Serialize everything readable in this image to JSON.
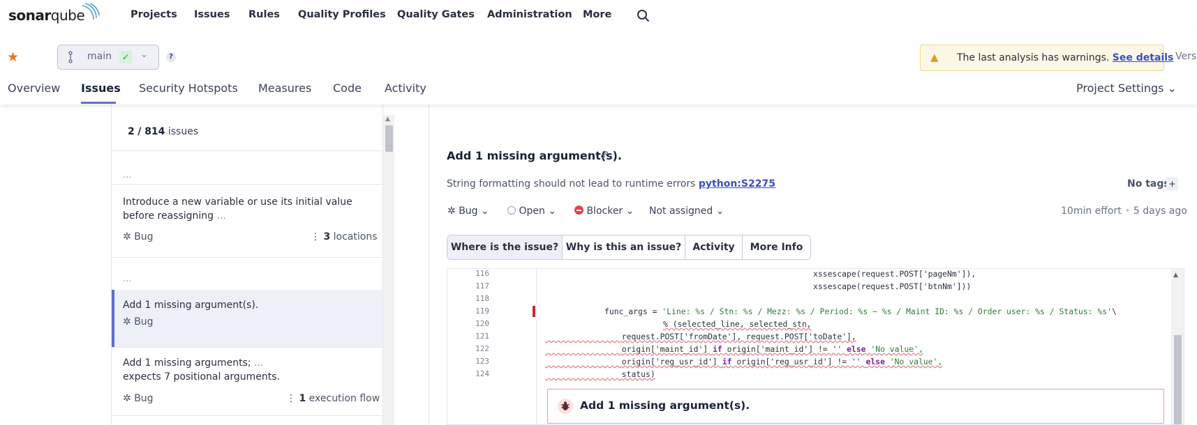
{
  "brand": {
    "name_bold": "sonar",
    "name_light": "qube"
  },
  "nav": [
    "Projects",
    "Issues",
    "Rules",
    "Quality Profiles",
    "Quality Gates",
    "Administration",
    "More"
  ],
  "branch": {
    "name": "main"
  },
  "help": "?",
  "warning": {
    "text": "The last analysis has warnings.",
    "link": "See details"
  },
  "version": "Versi",
  "tabs": [
    "Overview",
    "Issues",
    "Security Hotspots",
    "Measures",
    "Code",
    "Activity"
  ],
  "project_settings": "Project Settings",
  "list": {
    "count_current": "2",
    "count_total": "/ 814",
    "count_label": "issues",
    "faded_path_1": "...",
    "items": [
      {
        "title": "Introduce a new variable or use its initial value before reassigning",
        "title_faded": "...",
        "type": "Bug",
        "extra_count": "3",
        "extra_label": "locations"
      },
      {
        "title": "Add 1 missing argument(s).",
        "type": "Bug"
      },
      {
        "title": "Add 1 missing arguments;",
        "title_faded": "...",
        "title_2": "expects 7 positional arguments.",
        "type": "Bug",
        "extra_count": "1",
        "extra_label": "execution flow"
      }
    ]
  },
  "issue": {
    "title": "Add 1 missing argument(s).",
    "rule_desc": "String formatting should not lead to runtime errors",
    "rule_key": "python:S2275",
    "tags": "No tags",
    "tags_add": "+",
    "type": "Bug",
    "status": "Open",
    "severity": "Blocker",
    "assignee": "Not assigned",
    "effort": "10min effort",
    "age": "5 days ago",
    "tabs": [
      "Where is the issue?",
      "Why is this an issue?",
      "Activity",
      "More Info"
    ],
    "box_title": "Add 1 missing argument(s)."
  },
  "code": {
    "line_numbers": [
      "116",
      "117",
      "118",
      "119",
      "120",
      "121",
      "122",
      "123",
      "124"
    ],
    "l116": "xssescape(request.POST['pageNm']),",
    "l117": "xssescape(request.POST['btnNm']))",
    "l119a": "func_args = ",
    "l119s": "'Line: %s / Stn: %s / Mezz: %s / Period: %s ~ %s / Maint ID: %s / Order user: %s / Status: %s'",
    "l119b": "\\",
    "l120": "% (selected_line, selected_stn,",
    "l121": "request.POST['fromDate'], request.POST['toDate'],",
    "l122a": "origin['maint_id'] ",
    "l122k1": "if",
    "l122b": " origin['maint_id'] != '' ",
    "l122k2": "else",
    "l122s": " 'No value',",
    "l123a": "origin['reg_usr_id'] ",
    "l123k1": "if",
    "l123b": " origin['reg_usr_id'] != '' ",
    "l123k2": "else",
    "l123s": " 'No value',",
    "l124": "status)"
  },
  "colors": {
    "accent": "#5d6cd2",
    "blocker": "#d0262f",
    "warning_bg": "#fdf7e7",
    "link": "#3a4ec4"
  }
}
